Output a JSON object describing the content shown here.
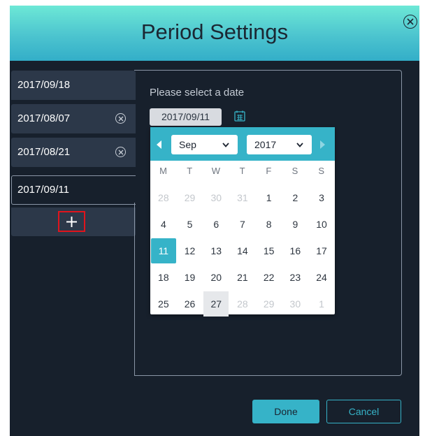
{
  "dialog": {
    "title": "Period Settings",
    "close_icon": "close-circle-icon"
  },
  "date_list": {
    "items": [
      {
        "label": "2017/09/18",
        "removable": false,
        "selected": false
      },
      {
        "label": "2017/08/07",
        "removable": true,
        "selected": false
      },
      {
        "label": "2017/08/21",
        "removable": true,
        "selected": false
      },
      {
        "label": "2017/09/11",
        "removable": false,
        "selected": true
      }
    ],
    "remove_icon": "remove-circle-icon",
    "add_icon": "plus-icon"
  },
  "panel": {
    "prompt": "Please select a date",
    "date_value": "2017/09/11",
    "calendar_icon": "calendar-icon"
  },
  "calendar": {
    "month": "Sep",
    "year": "2017",
    "weekdays": [
      "M",
      "T",
      "W",
      "T",
      "F",
      "S",
      "S"
    ],
    "weeks": [
      [
        "28",
        "29",
        "30",
        "31",
        "1",
        "2",
        "3"
      ],
      [
        "4",
        "5",
        "6",
        "7",
        "8",
        "9",
        "10"
      ],
      [
        "11",
        "12",
        "13",
        "14",
        "15",
        "16",
        "17"
      ],
      [
        "18",
        "19",
        "20",
        "21",
        "22",
        "23",
        "24"
      ],
      [
        "25",
        "26",
        "27",
        "28",
        "29",
        "30",
        "1"
      ]
    ],
    "selected_day": "11",
    "today_day": "27",
    "accent_color": "#36b3c8"
  },
  "footer": {
    "done_label": "Done",
    "cancel_label": "Cancel"
  }
}
